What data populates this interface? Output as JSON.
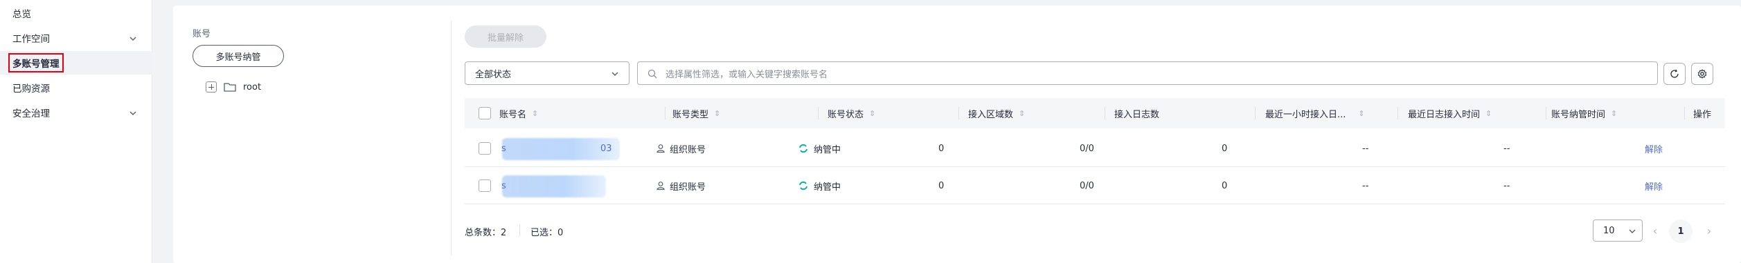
{
  "sidebar": {
    "items": [
      {
        "label": "总览"
      },
      {
        "label": "工作空间"
      },
      {
        "label": "多账号管理"
      },
      {
        "label": "已购资源"
      },
      {
        "label": "安全治理"
      }
    ]
  },
  "tree": {
    "title": "账号",
    "manage_button": "多账号纳管",
    "root_label": "root"
  },
  "toolbar": {
    "batch_remove": "批量解除",
    "status_select": "全部状态",
    "search_placeholder": "选择属性筛选，或输入关键字搜索账号名"
  },
  "table": {
    "headers": [
      "账号名",
      "账号类型",
      "账号状态",
      "接入区域数",
      "接入日志数",
      "最近一小时接入日...",
      "最近日志接入时间",
      "账号纳管时间",
      "操作"
    ],
    "rows": [
      {
        "name_start": "s",
        "name_end": "03",
        "type": "组织账号",
        "status": "纳管中",
        "regions": "0",
        "logs": "0/0",
        "last_hour": "0",
        "last_log_time": "--",
        "managed_time": "--",
        "action": "解除"
      },
      {
        "name_start": "s",
        "name_end": "",
        "type": "组织账号",
        "status": "纳管中",
        "regions": "0",
        "logs": "0/0",
        "last_hour": "0",
        "last_log_time": "--",
        "managed_time": "--",
        "action": "解除"
      }
    ]
  },
  "footer": {
    "total_label": "总条数：",
    "total_value": "2",
    "selected_label": "已选：",
    "selected_value": "0",
    "page_size": "10",
    "current_page": "1"
  },
  "colors": {
    "accent": "#526ecc",
    "highlight": "#e60012",
    "status_green": "#0bb4a0"
  }
}
